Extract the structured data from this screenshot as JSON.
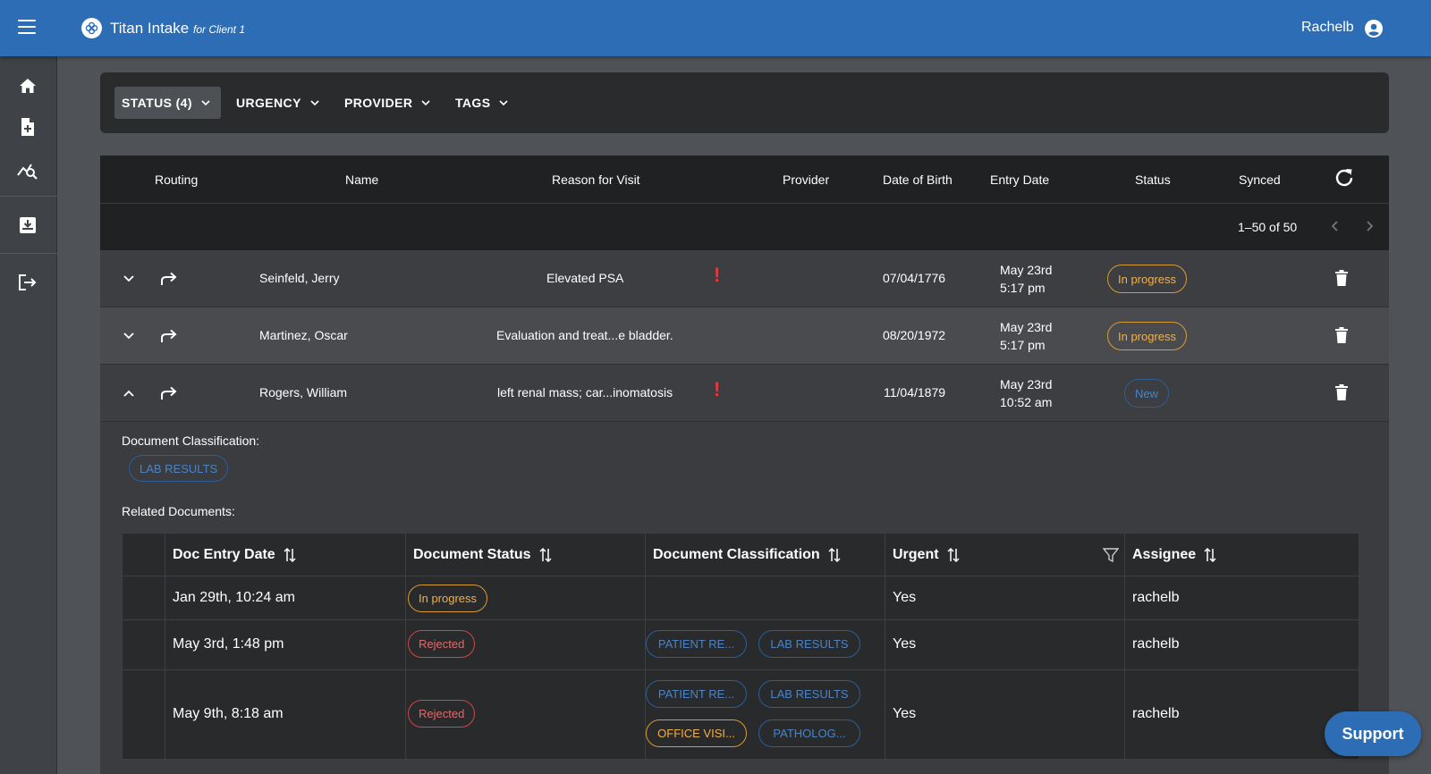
{
  "header": {
    "app_title": "Titan Intake",
    "app_subtitle": "for Client 1",
    "user_name": "Rachelb"
  },
  "filters": [
    {
      "label": "STATUS (4)",
      "active": true
    },
    {
      "label": "URGENCY",
      "active": false
    },
    {
      "label": "PROVIDER",
      "active": false
    },
    {
      "label": "TAGS",
      "active": false
    }
  ],
  "table": {
    "columns": [
      "Routing",
      "Name",
      "Reason for Visit",
      "Provider",
      "Date of Birth",
      "Entry Date",
      "Status",
      "Synced"
    ],
    "pagination": "1–50 of 50",
    "rows": [
      {
        "name": "Seinfeld, Jerry",
        "reason": "Elevated PSA",
        "urgent": "!",
        "dob": "07/04/1776",
        "entry_date": "May 23rd",
        "entry_time": "5:17 pm",
        "status": "In progress",
        "expanded": false
      },
      {
        "name": "Martinez, Oscar",
        "reason": "Evaluation and treat...e bladder.",
        "urgent": "",
        "dob": "08/20/1972",
        "entry_date": "May 23rd",
        "entry_time": "5:17 pm",
        "status": "In progress",
        "expanded": false
      },
      {
        "name": "Rogers, William",
        "reason": "left renal mass; car...inomatosis",
        "urgent": "!",
        "dob": "11/04/1879",
        "entry_date": "May 23rd",
        "entry_time": "10:52 am",
        "status": "New",
        "expanded": true
      }
    ]
  },
  "expanded": {
    "doc_class_label": "Document Classification:",
    "doc_class_value": "LAB RESULTS",
    "related_label": "Related Documents:",
    "columns": [
      "Doc Entry Date",
      "Document Status",
      "Document Classification",
      "Urgent",
      "Assignee"
    ],
    "rows": [
      {
        "date": "Jan 29th, 10:24 am",
        "status": "In progress",
        "classifications": [],
        "urgent": "Yes",
        "assignee": "rachelb"
      },
      {
        "date": "May 3rd, 1:48 pm",
        "status": "Rejected",
        "classifications": [
          "PATIENT RE...",
          "LAB RESULTS"
        ],
        "urgent": "Yes",
        "assignee": "rachelb"
      },
      {
        "date": "May 9th, 8:18 am",
        "status": "Rejected",
        "classifications": [
          "PATIENT RE...",
          "LAB RESULTS",
          "OFFICE VISI...",
          "PATHOLOG..."
        ],
        "urgent": "Yes",
        "assignee": "rachelb"
      }
    ]
  },
  "support_label": "Support",
  "colors": {
    "brand": "#2d6db5",
    "in_progress": "#f2b04b",
    "new": "#4a84c7",
    "rejected": "#e26a6a",
    "urgent": "#e0393e"
  }
}
